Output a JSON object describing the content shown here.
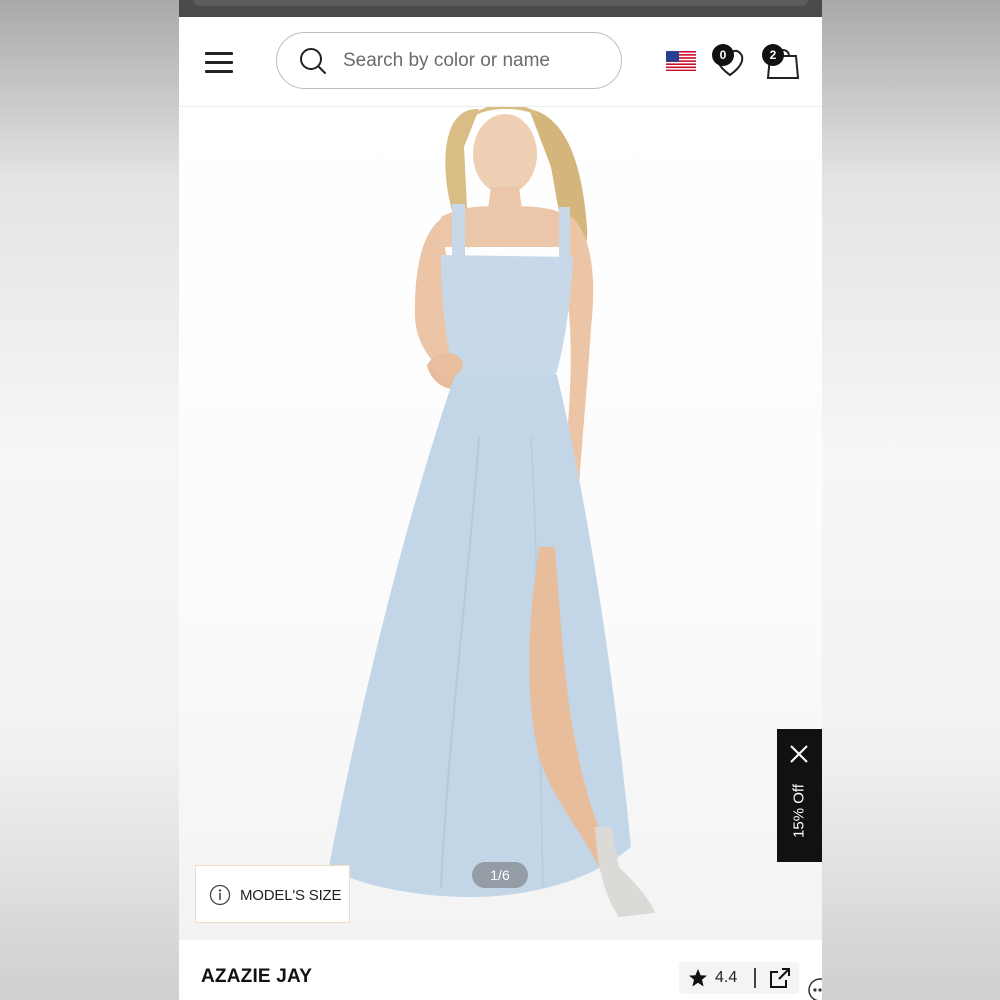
{
  "header": {
    "menu_icon": "hamburger-menu-icon",
    "search": {
      "placeholder": "Search by color or name",
      "icon": "search-icon"
    },
    "region_flag": "us-flag-icon",
    "wishlist_count": "0",
    "cart_count": "2"
  },
  "gallery": {
    "pager": "1/6",
    "model_size_label": "MODEL'S SIZE",
    "dress_color": "#c7d9e9"
  },
  "promo": {
    "label": "15% Off"
  },
  "product": {
    "name": "AZAZIE JAY",
    "rating": "4.4"
  },
  "colors": {
    "promo_bg": "#111111",
    "badge_bg": "#111111",
    "accent_border": "#f0dcc6"
  }
}
